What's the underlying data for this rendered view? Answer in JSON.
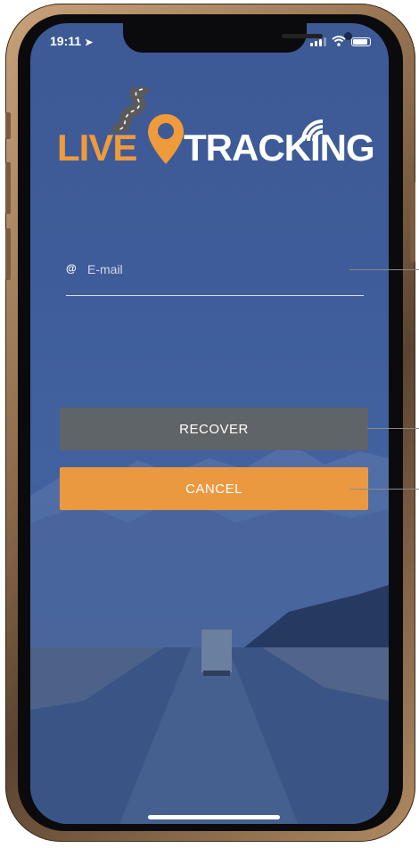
{
  "status_bar": {
    "time": "19:11"
  },
  "logo": {
    "word1": "LIVE",
    "word2": "TRACKING"
  },
  "email": {
    "placeholder": "E-mail",
    "value": ""
  },
  "buttons": {
    "recover": "RECOVER",
    "cancel": "CANCEL"
  },
  "colors": {
    "accent": "#eb9940",
    "recover_button": "#5f6468",
    "background": "#3e5c99"
  }
}
